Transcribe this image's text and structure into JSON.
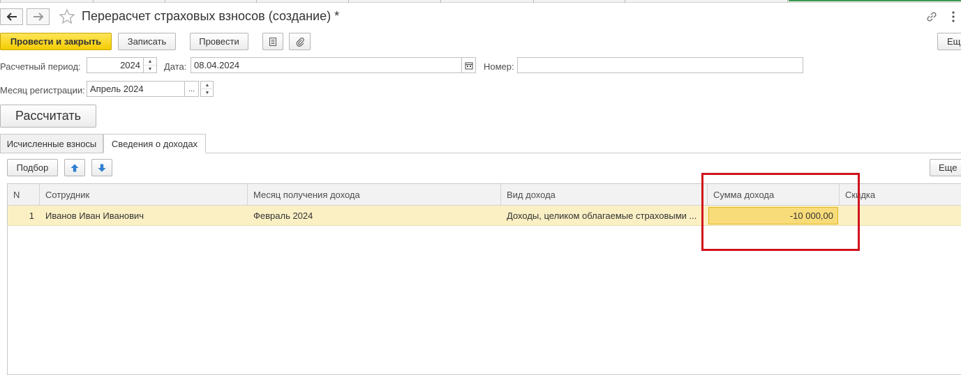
{
  "window": {
    "title": "Перерасчет страховых взносов (создание) *"
  },
  "icons": {
    "back": "arrow-left-icon",
    "forward": "arrow-right-icon",
    "favorite": "star-icon",
    "link": "link-icon",
    "more": "kebab-menu-icon",
    "list": "list-icon",
    "attach": "paperclip-icon",
    "calendar": "calendar-icon",
    "up": "arrow-up-icon",
    "down": "arrow-down-icon"
  },
  "toolbar": {
    "post_close_label": "Провести и закрыть",
    "save_label": "Записать",
    "post_label": "Провести",
    "more_label": "Ещ"
  },
  "form": {
    "period_label": "Расчетный период:",
    "period_value": "2024",
    "date_label": "Дата:",
    "date_value": "08.04.2024",
    "number_label": "Номер:",
    "number_value": "",
    "reg_month_label": "Месяц регистрации:",
    "reg_month_value": "Апрель 2024",
    "select_btn": "...",
    "calculate_label": "Рассчитать"
  },
  "tabs": [
    {
      "label": "Исчисленные взносы",
      "active": false
    },
    {
      "label": "Сведения о доходах",
      "active": true
    }
  ],
  "table_toolbar": {
    "pick_label": "Подбор",
    "more_label": "Еще"
  },
  "table": {
    "columns": [
      "N",
      "Сотрудник",
      "Месяц получения дохода",
      "Вид дохода",
      "Сумма дохода",
      "Скидка"
    ],
    "rows": [
      {
        "n": "1",
        "employee": "Иванов Иван Иванович",
        "month": "Февраль 2024",
        "income_type": "Доходы, целиком облагаемые страховыми ...",
        "amount": "-10 000,00",
        "discount": ""
      }
    ]
  },
  "colors": {
    "primary_button": "#f4cc00",
    "selected_row": "#fbf0c4",
    "active_cell": "#f9dc7a",
    "highlight_frame": "#d0121b"
  }
}
